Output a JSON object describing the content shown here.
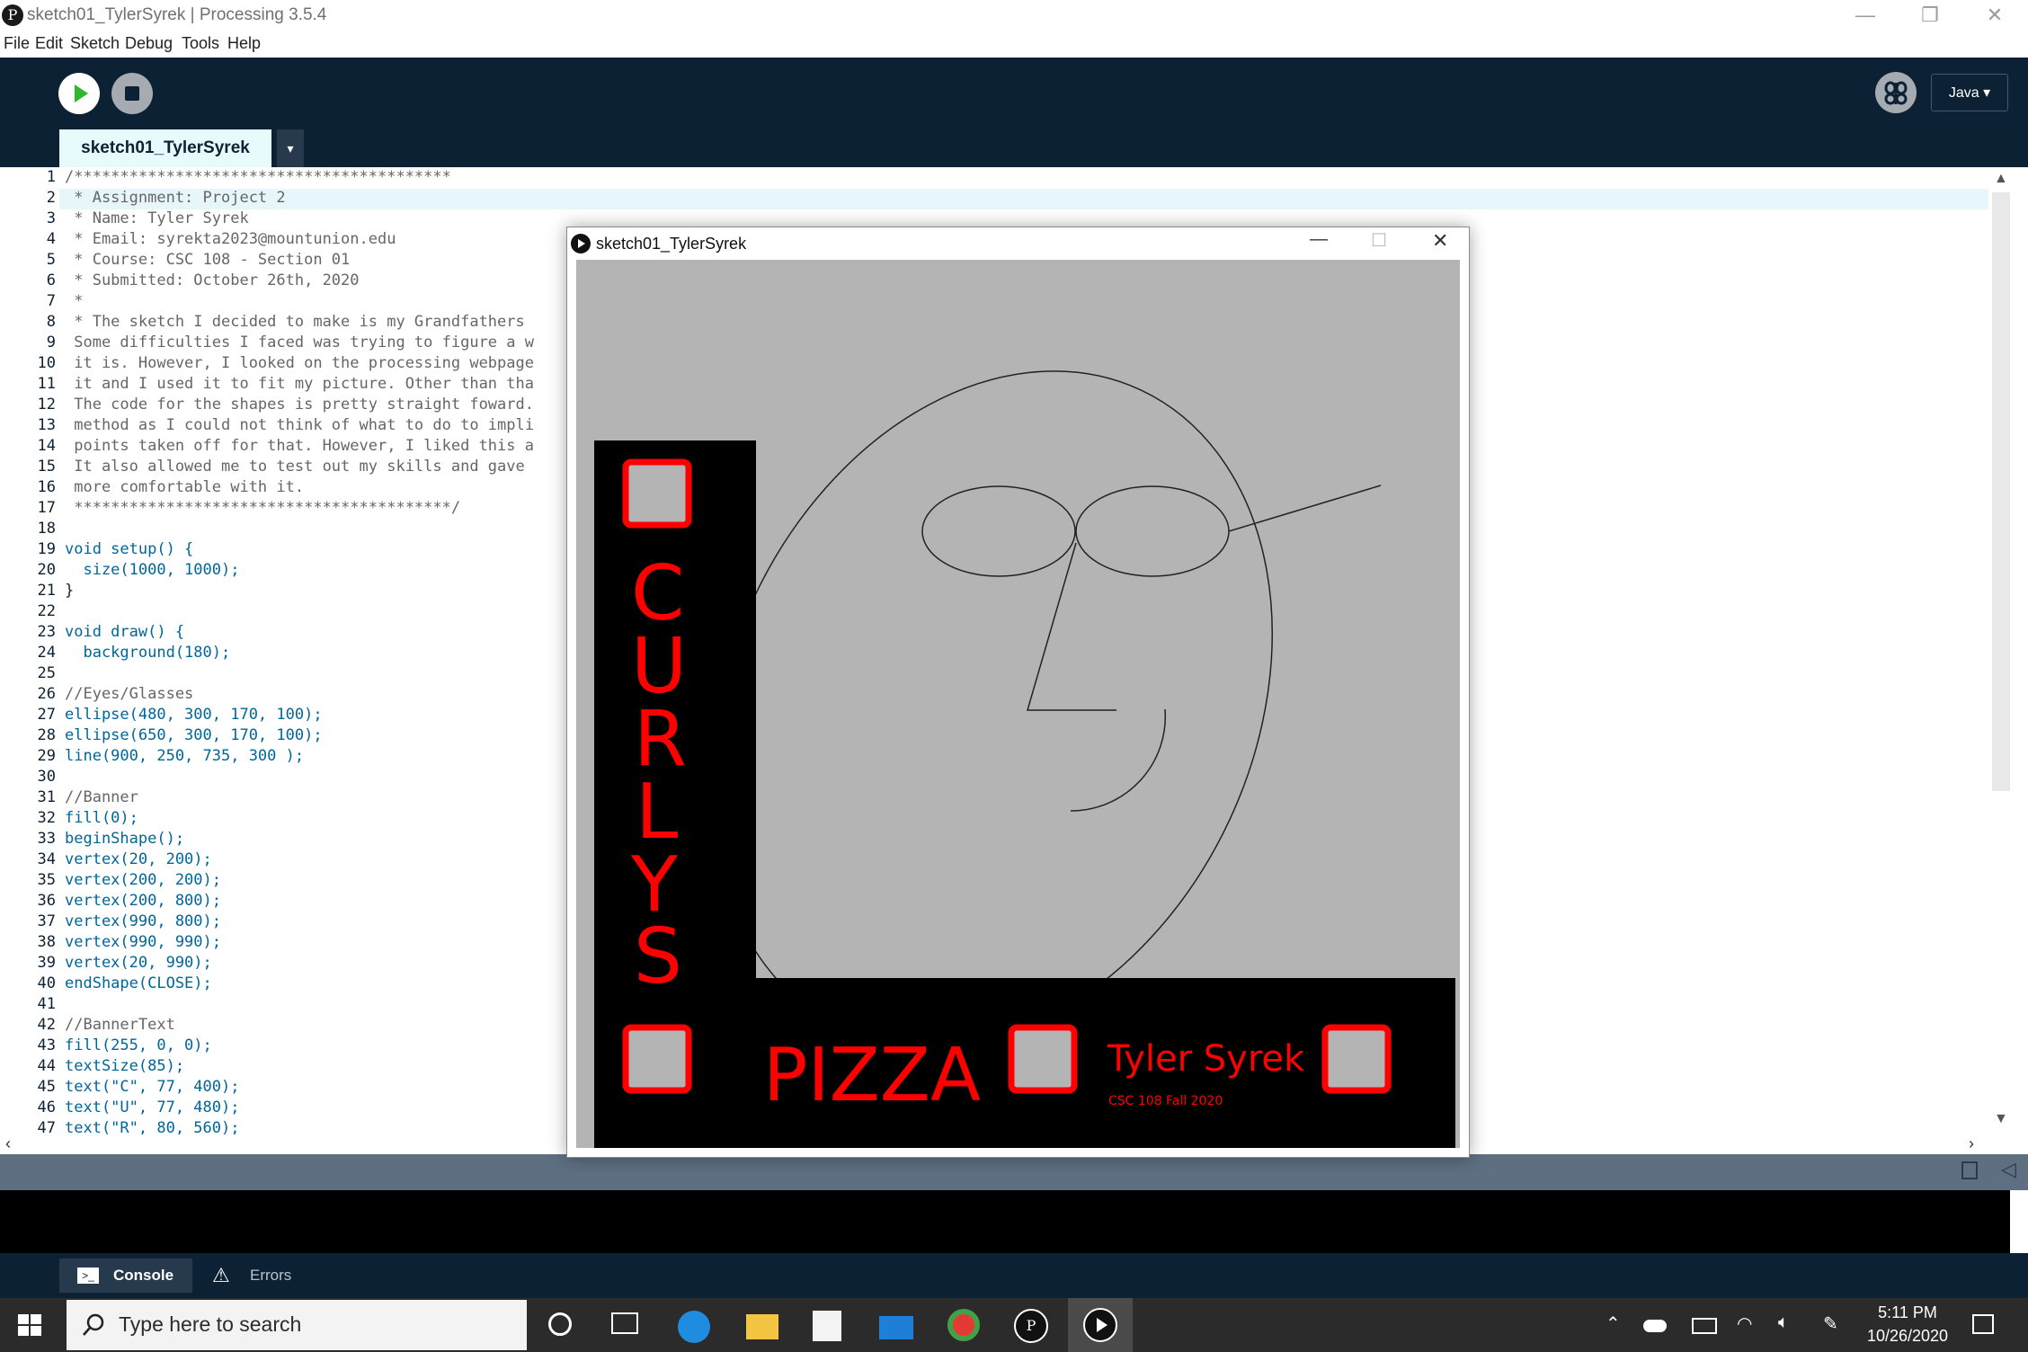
{
  "window": {
    "title": "sketch01_TylerSyrek | Processing 3.5.4",
    "icon": "processing-p3-icon"
  },
  "menu": [
    "File",
    "Edit",
    "Sketch",
    "Debug",
    "Tools",
    "Help"
  ],
  "toolbar": {
    "mode": "Java ▾",
    "tab": "sketch01_TylerSyrek",
    "tab_menu": "▾"
  },
  "editor": {
    "line_numbers": [
      "1",
      "2",
      "3",
      "4",
      "5",
      "6",
      "7",
      "8",
      "9",
      "10",
      "11",
      "12",
      "13",
      "14",
      "15",
      "16",
      "17",
      "18",
      "19",
      "20",
      "21",
      "22",
      "23",
      "24",
      "25",
      "26",
      "27",
      "28",
      "29",
      "30",
      "31",
      "32",
      "33",
      "34",
      "35",
      "36",
      "37",
      "38",
      "39",
      "40",
      "41",
      "42",
      "43",
      "44",
      "45",
      "46",
      "47"
    ],
    "lines": [
      "/*****************************************",
      " * Assignment: Project 2",
      " * Name: Tyler Syrek",
      " * Email: syrekta2023@mountunion.edu",
      " * Course: CSC 108 - Section 01",
      " * Submitted: October 26th, 2020",
      " *",
      " * The sketch I decided to make is my Grandfathers",
      " Some difficulties I faced was trying to figure a w",
      " it is. However, I looked on the processing webpage",
      " it and I used it to fit my picture. Other than tha",
      " The code for the shapes is pretty straight foward.",
      " method as I could not think of what to do to impli",
      " points taken off for that. However, I liked this a",
      " It also allowed me to test out my skills and gave ",
      " more comfortable with it.",
      " *****************************************/",
      "",
      "void setup() {",
      "  size(1000, 1000);",
      "}",
      "",
      "void draw() {",
      "  background(180);",
      "",
      "//Eyes/Glasses",
      "ellipse(480, 300, 170, 100);",
      "ellipse(650, 300, 170, 100);",
      "line(900, 250, 735, 300 );",
      "",
      "//Banner",
      "fill(0);",
      "beginShape();",
      "vertex(20, 200);",
      "vertex(200, 200);",
      "vertex(200, 800);",
      "vertex(990, 800);",
      "vertex(990, 990);",
      "vertex(20, 990);",
      "endShape(CLOSE);",
      "",
      "//BannerText",
      "fill(255, 0, 0);",
      "textSize(85);",
      "text(\"C\", 77, 400);",
      "text(\"U\", 77, 480);",
      "text(\"R\", 80, 560);"
    ]
  },
  "console_tabs": {
    "console": "Console",
    "errors": "Errors"
  },
  "sketch_window": {
    "title": "sketch01_TylerSyrek",
    "banner_letters": [
      "C",
      "U",
      "R",
      "L",
      "Y",
      "S"
    ],
    "pizza": "PIZZA",
    "author": "Tyler Syrek",
    "course": "CSC 108 Fall 2020",
    "colors": {
      "canvas": "#b4b4b4",
      "banner": "#000000",
      "text": "#ff0000"
    }
  },
  "taskbar": {
    "search_placeholder": "Type here to search",
    "time": "5:11 PM",
    "date": "10/26/2020"
  }
}
